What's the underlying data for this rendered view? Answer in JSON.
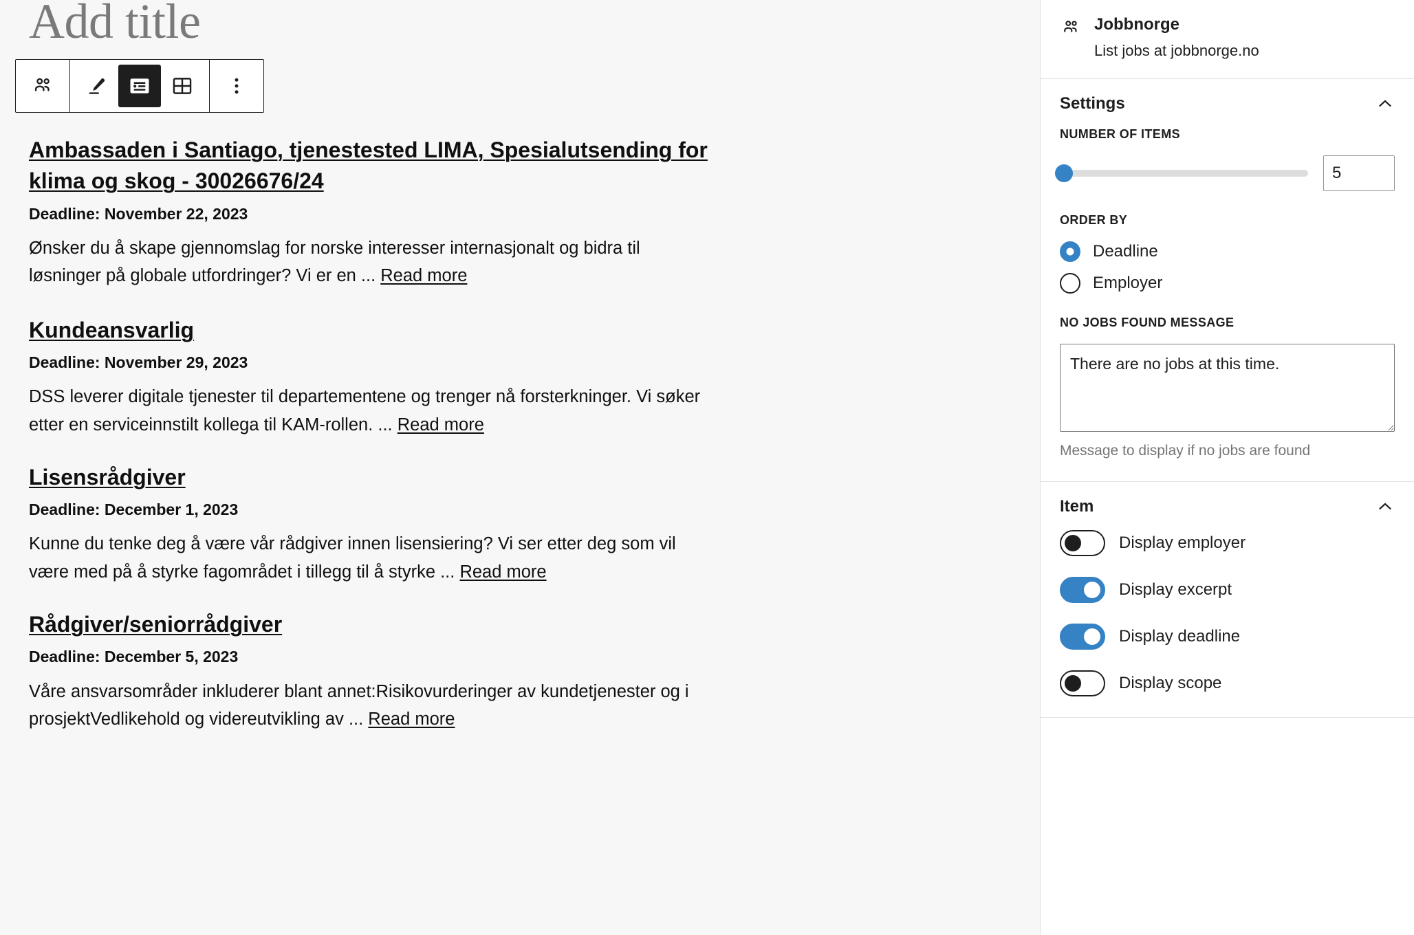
{
  "editor": {
    "title_placeholder": "Add title",
    "toolbar": {
      "items": [
        {
          "icon": "block-type-people-icon",
          "label": "Jobbnorge block",
          "active": false
        },
        {
          "icon": "pencil-edit-icon",
          "label": "Edit",
          "active": false
        },
        {
          "icon": "list-view-icon",
          "label": "List view",
          "active": true
        },
        {
          "icon": "grid-view-icon",
          "label": "Grid view",
          "active": false
        },
        {
          "icon": "more-options-icon",
          "label": "Options",
          "active": false
        }
      ]
    },
    "jobs": [
      {
        "title": "Ambassaden i Santiago, tjenestested LIMA, Spesialutsending for klima og skog - 30026676/24",
        "deadline": "Deadline: November 22, 2023",
        "excerpt": "Ønsker du å skape gjennomslag for norske interesser internasjonalt og bidra til løsninger på globale utfordringer? Vi er en ...",
        "read_more": "Read more"
      },
      {
        "title": "Kundeansvarlig",
        "deadline": "Deadline: November 29, 2023",
        "excerpt": "DSS leverer digitale tjenester til departementene og trenger nå forsterkninger. Vi søker etter en serviceinnstilt kollega til KAM-rollen. ...",
        "read_more": "Read more"
      },
      {
        "title": "Lisensrådgiver",
        "deadline": "Deadline: December 1, 2023",
        "excerpt": "Kunne du tenke deg å være vår rådgiver innen lisensiering? Vi ser etter deg som vil være med på å styrke fagområdet i tillegg til å styrke ...",
        "read_more": "Read more"
      },
      {
        "title": "Rådgiver/seniorrådgiver",
        "deadline": "Deadline: December 5, 2023",
        "excerpt": "Våre ansvarsområder inkluderer blant annet:Risikovurderinger av kundetjenester og i prosjektVedlikehold og videreutvikling av ...",
        "read_more": "Read more"
      }
    ]
  },
  "sidebar": {
    "block_card": {
      "icon": "people-group-icon",
      "title": "Jobbnorge",
      "description": "List jobs at jobbnorge.no"
    },
    "settings": {
      "title": "Settings",
      "collapse_icon": "chevron-up-icon",
      "number_of_items": {
        "label": "NUMBER OF ITEMS",
        "value": "5",
        "min": "1",
        "max": "100",
        "slider_percent": 1
      },
      "order_by": {
        "label": "ORDER BY",
        "options": [
          {
            "label": "Deadline",
            "checked": true
          },
          {
            "label": "Employer",
            "checked": false
          }
        ]
      },
      "no_jobs_message": {
        "label": "NO JOBS FOUND MESSAGE",
        "value": "There are no jobs at this time.",
        "placeholder": "There are no jobs at this time.",
        "help": "Message to display if no jobs are found"
      }
    },
    "item": {
      "title": "Item",
      "collapse_icon": "chevron-up-icon",
      "toggles": [
        {
          "label": "Display employer",
          "on": false
        },
        {
          "label": "Display excerpt",
          "on": true
        },
        {
          "label": "Display deadline",
          "on": true
        },
        {
          "label": "Display scope",
          "on": false
        }
      ]
    }
  },
  "colors": {
    "accent": "#3582c4",
    "ink": "#1e1e1e",
    "canvas": "#f7f7f7",
    "border": "#e0e0e0",
    "muted": "#757575"
  }
}
